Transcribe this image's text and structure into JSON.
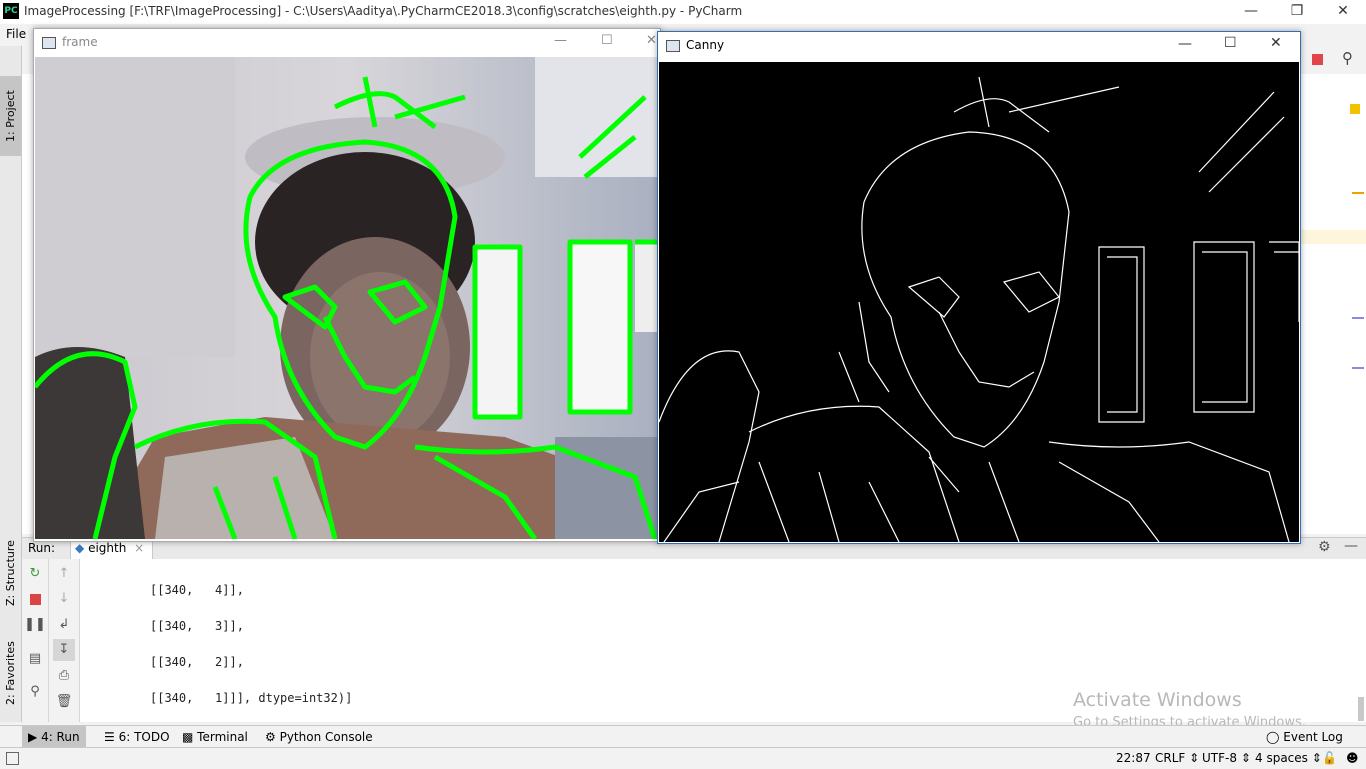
{
  "window": {
    "title": "ImageProcessing [F:\\TRF\\ImageProcessing] - C:\\Users\\Aaditya\\.PyCharmCE2018.3\\config\\scratches\\eighth.py - PyCharm",
    "app_icon": "PC"
  },
  "menu": {
    "file": "File"
  },
  "left_strip": {
    "project_tab": "1: Project",
    "structure_tab": "Z: Structure",
    "favorites_tab": "2: Favorites"
  },
  "run_panel": {
    "label": "Run:",
    "tab": "eighth",
    "console_lines": [
      "[[340,   4]],",
      "[[340,   3]],",
      "[[340,   2]],",
      "[[340,   1]]], dtype=int32)]"
    ]
  },
  "frame_window": {
    "title": "frame"
  },
  "canny_window": {
    "title": "Canny"
  },
  "watermark": {
    "line1": "Activate Windows",
    "line2": "Go to Settings to activate Windows."
  },
  "bottom_tabs": {
    "run": "4: Run",
    "todo": "6: TODO",
    "terminal": "Terminal",
    "python_console": "Python Console",
    "event_log": "Event Log"
  },
  "status": {
    "position": "22:87",
    "line_sep": "CRLF",
    "encoding": "UTF-8",
    "indent": "4 spaces"
  },
  "colors": {
    "contour": "#00ff00",
    "canny_bg": "#000000",
    "accent": "#2f6fb5"
  }
}
